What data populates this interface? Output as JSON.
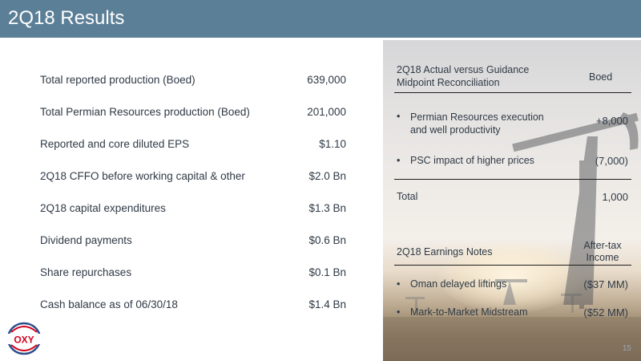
{
  "header": {
    "title": "2Q18 Results"
  },
  "metrics": [
    {
      "label": "Total reported production (Boed)",
      "value": "639,000"
    },
    {
      "label": "Total Permian Resources production (Boed)",
      "value": "201,000"
    },
    {
      "label": "Reported and core diluted EPS",
      "value": "$1.10"
    },
    {
      "label": "2Q18 CFFO before working capital & other",
      "value": "$2.0 Bn"
    },
    {
      "label": "2Q18 capital expenditures",
      "value": "$1.3 Bn"
    },
    {
      "label": "Dividend payments",
      "value": "$0.6 Bn"
    },
    {
      "label": "Share repurchases",
      "value": "$0.1 Bn"
    },
    {
      "label": "Cash balance as of 06/30/18",
      "value": "$1.4 Bn"
    }
  ],
  "reconciliation": {
    "heading_line1": "2Q18 Actual versus Guidance",
    "heading_line2": "Midpoint Reconciliation",
    "unit": "Boed",
    "rows": [
      {
        "label_line1": "Permian Resources execution",
        "label_line2": "and well productivity",
        "value": "+8,000"
      },
      {
        "label_line1": "PSC impact of higher prices",
        "label_line2": "",
        "value": "(7,000)"
      }
    ],
    "total_label": "Total",
    "total_value": "1,000"
  },
  "earnings_notes": {
    "heading": "2Q18 Earnings Notes",
    "unit_line1": "After-tax",
    "unit_line2": "Income",
    "rows": [
      {
        "label": "Oman delayed liftings",
        "value": "($37 MM)"
      },
      {
        "label": "Mark-to-Market Midstream",
        "value": "($52 MM)"
      }
    ]
  },
  "bullet_char": "•",
  "page_number": "15",
  "logo": {
    "text": "OXY",
    "color": "#d0021b"
  }
}
